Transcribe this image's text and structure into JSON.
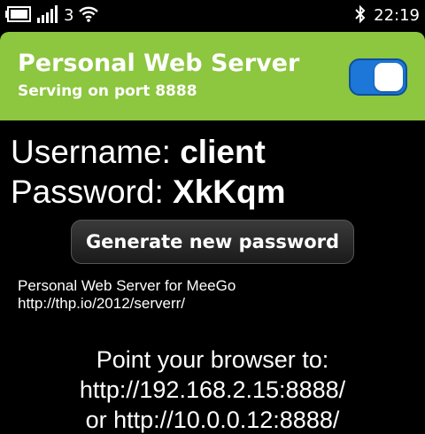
{
  "status_bar": {
    "network_label": "3",
    "time": "22:19",
    "icons": [
      "battery-icon",
      "signal-icon",
      "wifi-icon",
      "bluetooth-icon"
    ]
  },
  "header": {
    "title": "Personal Web Server",
    "subtitle": "Serving on port 8888",
    "toggle_on": true,
    "colors": {
      "background": "#8dc63f",
      "toggle": "#1c77d8"
    }
  },
  "credentials": {
    "username_label": "Username:",
    "username_value": "client",
    "password_label": "Password:",
    "password_value": "XkKqm"
  },
  "actions": {
    "generate_label": "Generate new password"
  },
  "about": {
    "name": "Personal Web Server for MeeGo",
    "url": "http://thp.io/2012/serverr/"
  },
  "instructions": {
    "line1": "Point your browser to:",
    "line2": "http://192.168.2.15:8888/",
    "line3": "or http://10.0.0.12:8888/"
  }
}
